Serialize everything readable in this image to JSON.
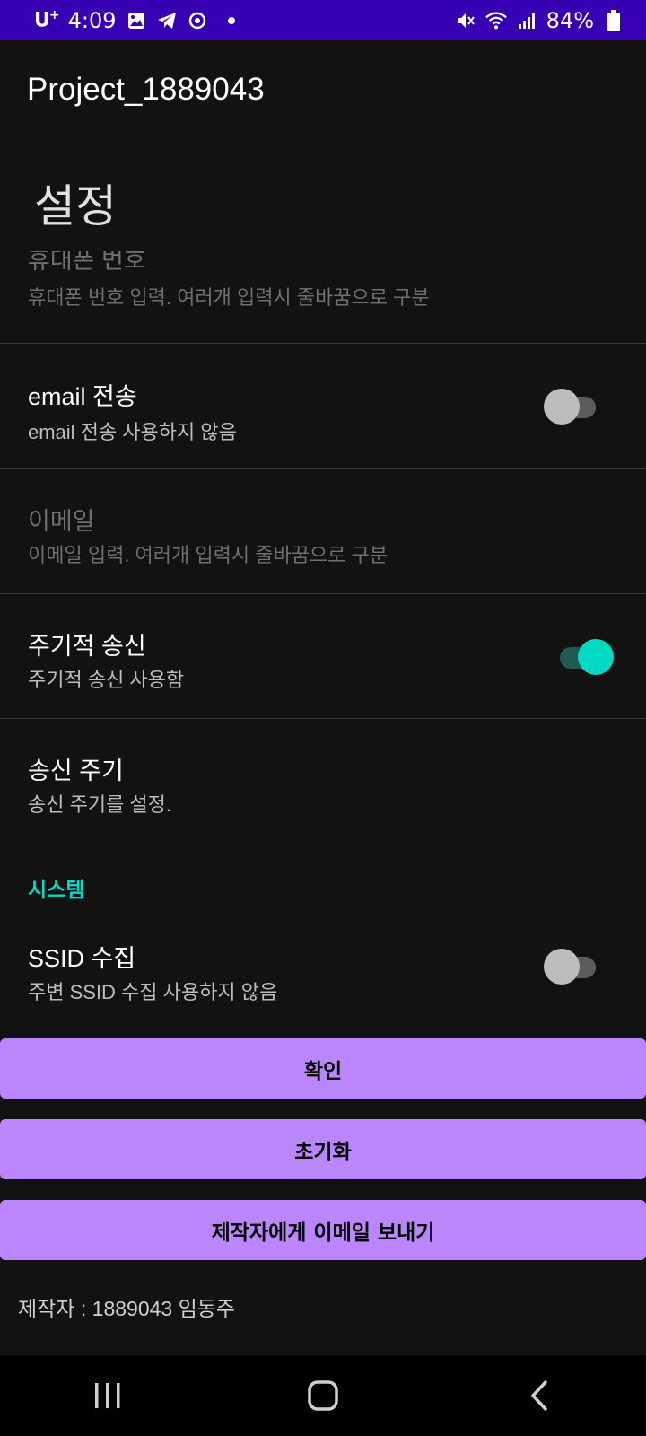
{
  "status_bar": {
    "carrier": "U",
    "carrier_sup": "+",
    "time": "4:09",
    "battery": "84%"
  },
  "app_bar": {
    "title": "Project_1889043"
  },
  "page": {
    "title": "설정"
  },
  "preferences": {
    "phone": {
      "title": "휴대폰 번호",
      "summary": "휴대폰 번호 입력. 여러개 입력시 줄바꿈으로 구분"
    },
    "email_send": {
      "title": "email 전송",
      "summary": "email 전송 사용하지 않음",
      "enabled": false
    },
    "email": {
      "title": "이메일",
      "summary": "이메일 입력. 여러개 입력시 줄바꿈으로 구분"
    },
    "periodic": {
      "title": "주기적 송신",
      "summary": "주기적 송신 사용함",
      "enabled": true
    },
    "interval": {
      "title": "송신 주기",
      "summary": "송신 주기를 설정."
    }
  },
  "system": {
    "category": "시스템",
    "ssid": {
      "title": "SSID 수집",
      "summary": "주변 SSID 수집 사용하지 않음",
      "enabled": false
    }
  },
  "buttons": {
    "confirm": "확인",
    "reset": "초기화",
    "email_dev": "제작자에게 이메일 보내기"
  },
  "author": "제작자 : 1889043 임동주",
  "colors": {
    "status_bar": "#3700b3",
    "background": "#121212",
    "accent": "#03dac5",
    "button": "#bb86fc"
  }
}
